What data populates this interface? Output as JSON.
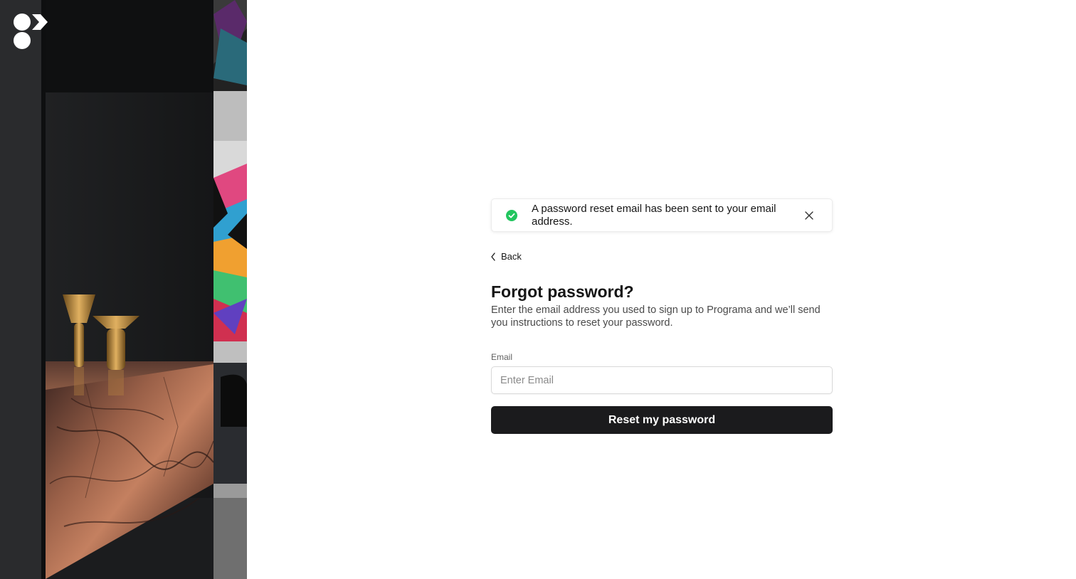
{
  "brand": {
    "logo_icon": "programa-logo-icon",
    "accent_color": "#1b1b1d"
  },
  "notification": {
    "type": "success",
    "icon": "check-circle-icon",
    "status_color": "#22c55e",
    "message": "A password reset email has been sent to your email address.",
    "close_icon": "close-icon"
  },
  "nav": {
    "back_icon": "chevron-left-icon",
    "back_label": "Back"
  },
  "form": {
    "title": "Forgot password?",
    "description": "Enter the email address you used to sign up to Programa and we’ll send you instructions to reset your password.",
    "email": {
      "label": "Email",
      "placeholder": "Enter Email",
      "value": ""
    },
    "submit_label": "Reset my password"
  }
}
